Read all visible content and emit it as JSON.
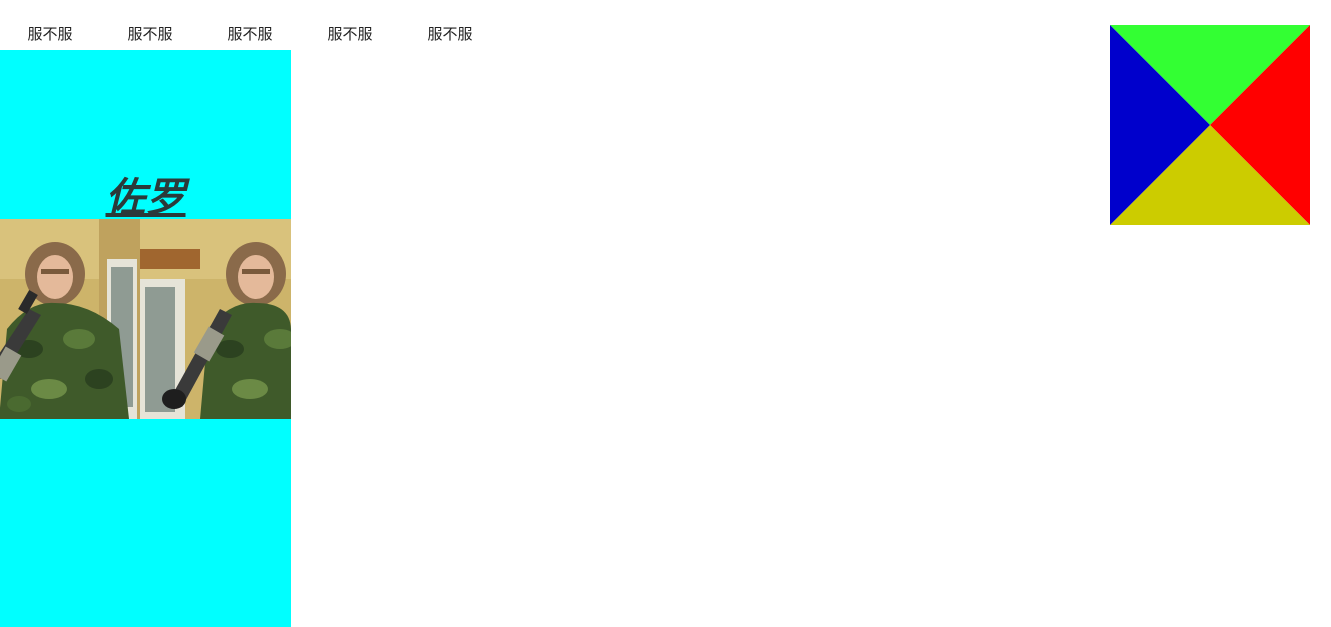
{
  "nav": {
    "items": [
      {
        "label": "服不服"
      },
      {
        "label": "服不服"
      },
      {
        "label": "服不服"
      },
      {
        "label": "服不服"
      },
      {
        "label": "服不服"
      }
    ]
  },
  "sidebar": {
    "background": "#00ffff",
    "heading": "佐罗",
    "photo": {
      "subject": "woman-with-rifle-camouflage",
      "tiles": 2
    }
  },
  "quad_square": {
    "colors": {
      "top": "#33ff33",
      "right": "#ff0000",
      "bottom": "#cccc00",
      "left": "#0000cc"
    }
  }
}
